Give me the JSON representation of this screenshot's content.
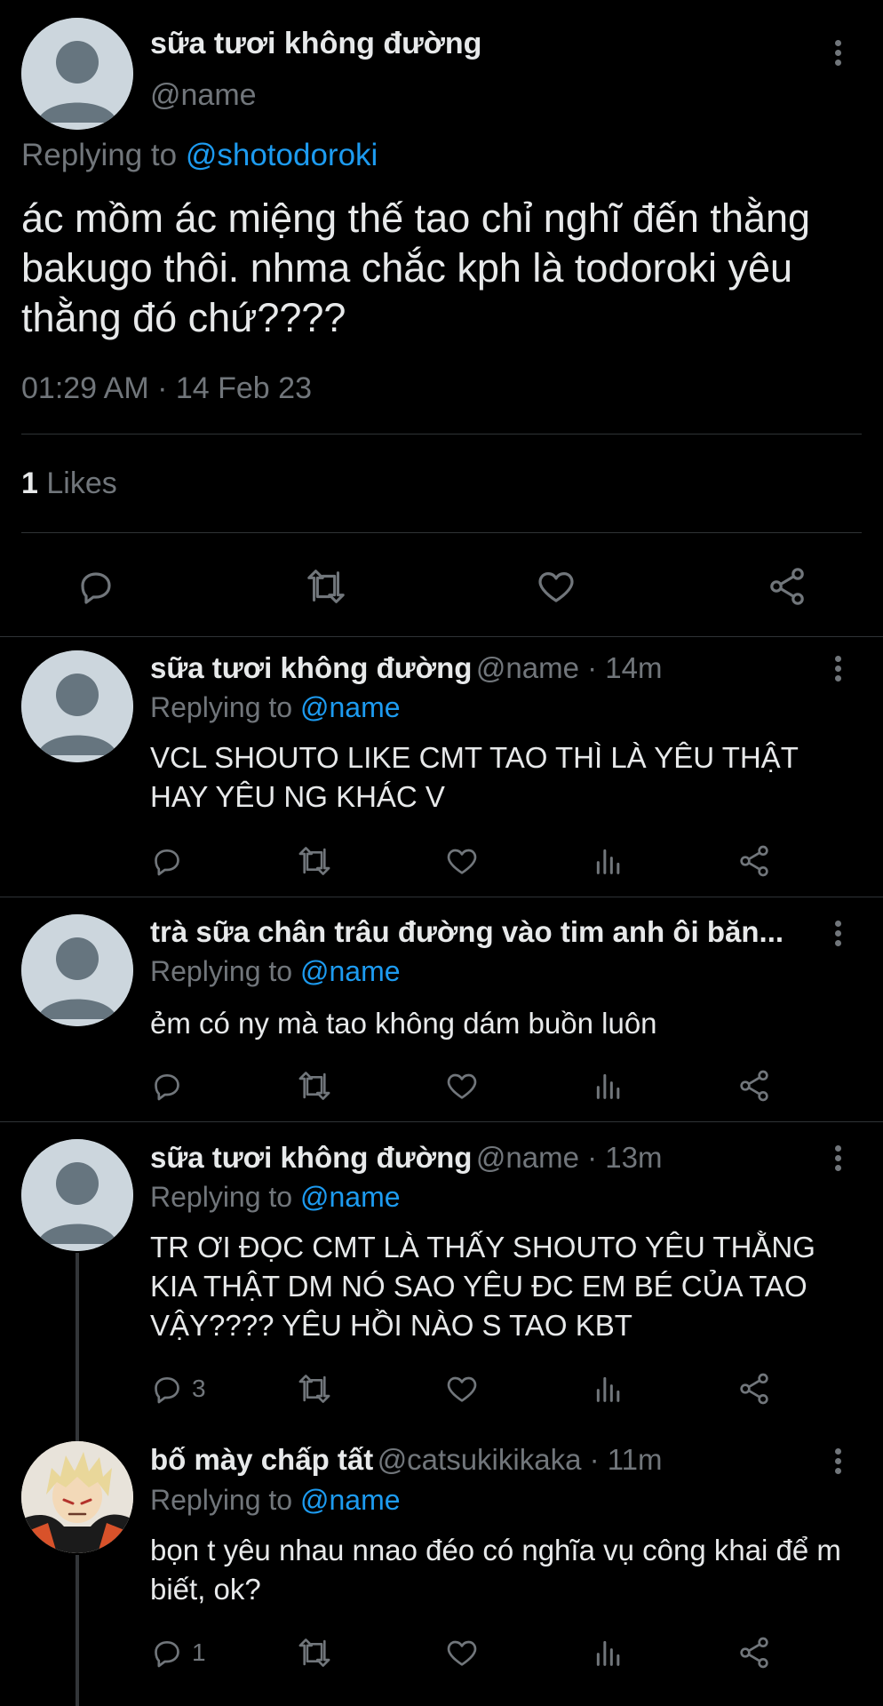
{
  "main_tweet": {
    "display_name": "sữa tươi không đường",
    "handle": "@name",
    "replying_prefix": "Replying to",
    "replying_to": "@shotodoroki",
    "text": "ác mồm ác miệng thế tao chỉ nghĩ đến thằng bakugo thôi. nhma chắc kph là todoroki yêu thằng đó chứ????",
    "timestamp": "01:29 AM · 14 Feb 23",
    "likes_count": "1",
    "likes_label": "Likes",
    "actions": [
      "reply-icon",
      "retweet-icon",
      "like-icon",
      "share-icon"
    ]
  },
  "replies": [
    {
      "display_name": "sữa tươi không đường",
      "meta": "@name · 14m",
      "replying_prefix": "Replying to",
      "replying_to": "@name",
      "text": "VCL SHOUTO LIKE CMT TAO THÌ LÀ YÊU THẬT HAY YÊU NG KHÁC V",
      "reply_count": ""
    },
    {
      "display_name": "trà sữa chân trâu đường vào tim anh ôi băn...",
      "meta": "",
      "replying_prefix": "Replying to",
      "replying_to": "@name",
      "text": "ẻm có ny mà tao không dám buồn luôn",
      "reply_count": ""
    },
    {
      "display_name": "sữa tươi không đường",
      "meta": "@name · 13m",
      "replying_prefix": "Replying to",
      "replying_to": "@name",
      "text": "TR ƠI ĐỌC CMT LÀ THẤY SHOUTO YÊU THẰNG KIA THẬT DM NÓ SAO YÊU ĐC EM BÉ CỦA TAO VẬY???? YÊU HỒI NÀO S TAO KBT",
      "reply_count": "3"
    },
    {
      "display_name": "bố mày chấp tất",
      "meta": "@catsukikikaka · 11m",
      "replying_prefix": "Replying to",
      "replying_to": "@name",
      "text": "bọn t yêu nhau nnao đéo có nghĩa vụ công khai để m biết, ok?",
      "reply_count": "1"
    }
  ],
  "colors": {
    "background": "#000000",
    "text": "#e7e9ea",
    "muted": "#71767b",
    "link": "#1d9bf0",
    "divider": "#2f3336"
  }
}
